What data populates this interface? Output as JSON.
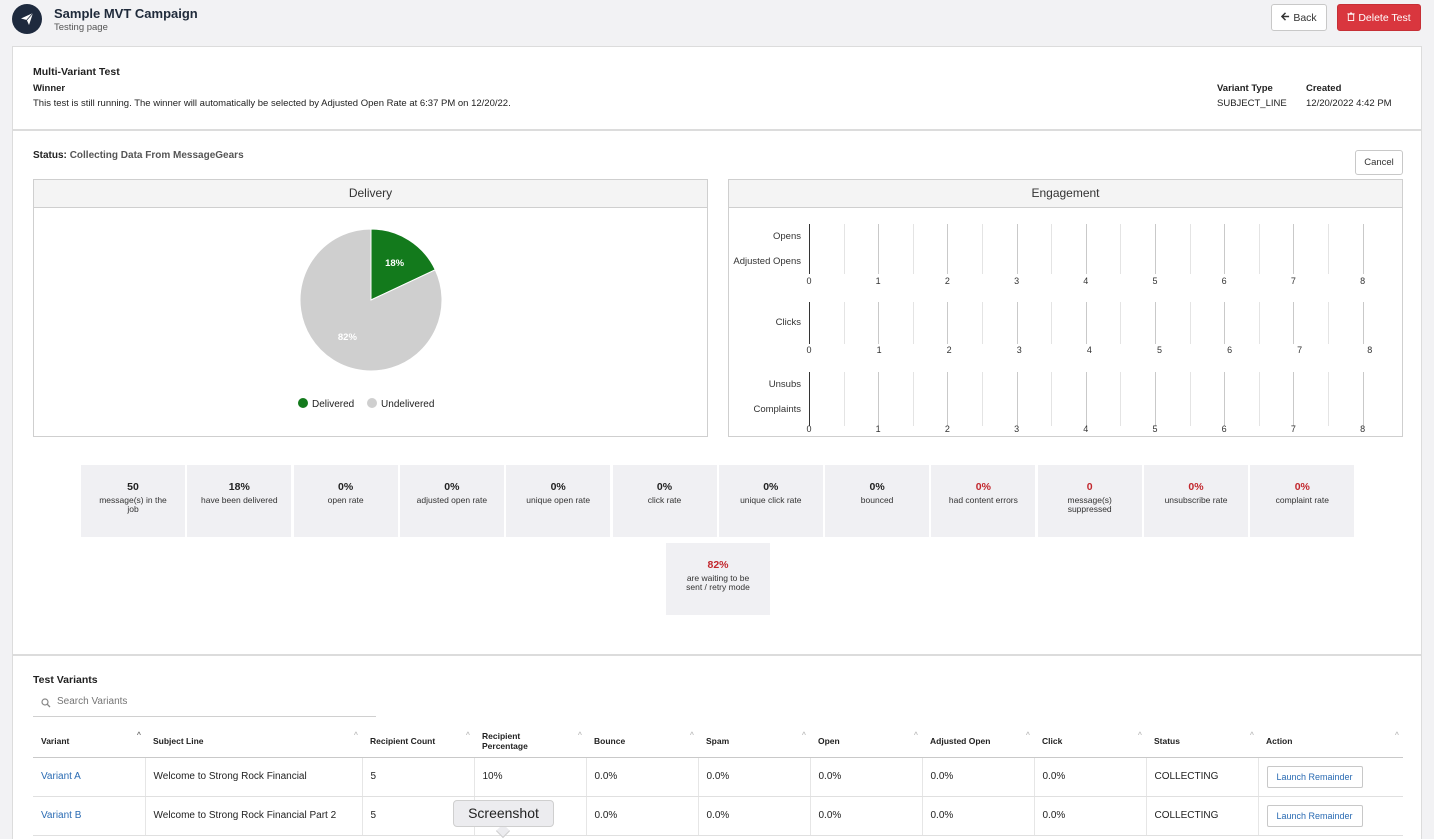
{
  "header": {
    "title": "Sample MVT Campaign",
    "subtitle": "Testing page",
    "back_label": "Back",
    "delete_label": "Delete Test",
    "icon": "paper-plane-icon"
  },
  "info": {
    "heading": "Multi-Variant Test",
    "winner_label": "Winner",
    "winner_text": "This test is still running. The winner will automatically be selected by Adjusted Open Rate at 6:37 PM on 12/20/22.",
    "variant_type_label": "Variant Type",
    "variant_type_value": "SUBJECT_LINE",
    "created_label": "Created",
    "created_value": "12/20/2022 4:42 PM"
  },
  "status": {
    "label": "Status:",
    "value": "Collecting Data From MessageGears",
    "cancel_label": "Cancel"
  },
  "delivery": {
    "title": "Delivery",
    "legend_delivered": "Delivered",
    "legend_undelivered": "Undelivered",
    "colors": {
      "delivered": "#137a1c",
      "undelivered": "#cfcfcf"
    }
  },
  "engagement": {
    "title": "Engagement",
    "group1": [
      "Opens",
      "Adjusted Opens"
    ],
    "group2": [
      "Clicks"
    ],
    "group3": [
      "Unsubs",
      "Complaints"
    ],
    "ticks": [
      "0",
      "1",
      "2",
      "3",
      "4",
      "5",
      "6",
      "7",
      "8"
    ]
  },
  "chart_data": [
    {
      "type": "pie",
      "title": "Delivery",
      "categories": [
        "Delivered",
        "Undelivered"
      ],
      "values": [
        18,
        82
      ],
      "labels": [
        "18%",
        "82%"
      ],
      "legend": "bottom"
    },
    {
      "type": "bar",
      "title": "Engagement",
      "orientation": "horizontal",
      "categories": [
        "Opens",
        "Adjusted Opens",
        "Clicks",
        "Unsubs",
        "Complaints"
      ],
      "values": [
        0,
        0,
        0,
        0,
        0
      ],
      "xlim": [
        0,
        8
      ]
    }
  ],
  "stats": [
    {
      "value": "50",
      "label": "message(s) in the job",
      "red": false
    },
    {
      "value": "18%",
      "label": "have been delivered",
      "red": false
    },
    {
      "value": "0%",
      "label": "open rate",
      "red": false
    },
    {
      "value": "0%",
      "label": "adjusted open rate",
      "red": false
    },
    {
      "value": "0%",
      "label": "unique open rate",
      "red": false
    },
    {
      "value": "0%",
      "label": "click rate",
      "red": false
    },
    {
      "value": "0%",
      "label": "unique click rate",
      "red": false
    },
    {
      "value": "0%",
      "label": "bounced",
      "red": false
    },
    {
      "value": "0%",
      "label": "had content errors",
      "red": true
    },
    {
      "value": "0",
      "label": "message(s) suppressed",
      "red": true
    },
    {
      "value": "0%",
      "label": "unsubscribe rate",
      "red": true
    },
    {
      "value": "0%",
      "label": "complaint rate",
      "red": true
    },
    {
      "value": "82%",
      "label": "are waiting to be sent / retry mode",
      "red": true
    }
  ],
  "variants": {
    "heading": "Test Variants",
    "search_placeholder": "Search Variants",
    "columns": [
      "Variant",
      "Subject Line",
      "Recipient Count",
      "Recipient Percentage",
      "Bounce",
      "Spam",
      "Open",
      "Adjusted Open",
      "Click",
      "Status",
      "Action"
    ],
    "rows": [
      {
        "variant": "Variant A",
        "subject": "Welcome to Strong Rock Financial",
        "count": "5",
        "pct": "10%",
        "bounce": "0.0%",
        "spam": "0.0%",
        "open": "0.0%",
        "adj_open": "0.0%",
        "click": "0.0%",
        "status": "COLLECTING",
        "action": "Launch Remainder"
      },
      {
        "variant": "Variant B",
        "subject": "Welcome to Strong Rock Financial Part 2",
        "count": "5",
        "pct": "",
        "bounce": "0.0%",
        "spam": "0.0%",
        "open": "0.0%",
        "adj_open": "0.0%",
        "click": "0.0%",
        "status": "COLLECTING",
        "action": "Launch Remainder"
      }
    ]
  },
  "tooltip": "Screenshot"
}
